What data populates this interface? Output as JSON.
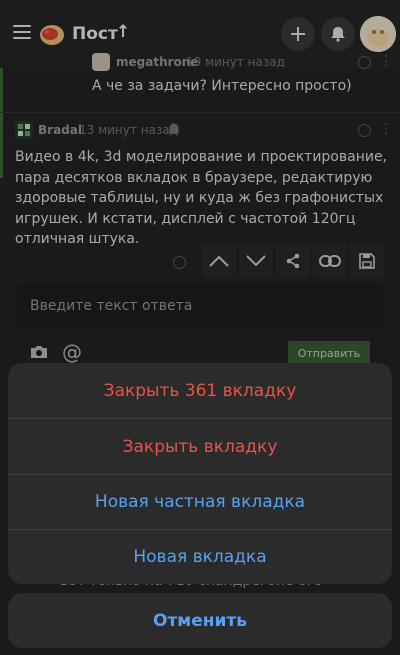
{
  "header": {
    "title": "Пост",
    "up_arrow": "↑"
  },
  "comment1": {
    "author": "megathrone",
    "time": "19 минут назад",
    "text": "А че за задачи? Интересно просто)"
  },
  "comment2": {
    "author": "Bradal",
    "time": "13 минут назад",
    "text": "Видео в 4k, 3d моделирование и проектирование, пара десятков вкладок в браузере, редактирую здоровые таблицы, ну и куда ж без графонистых игрушек. И кстати, дисплей с частотой 120гц отличная штука."
  },
  "reply": {
    "placeholder": "Введите текст ответа",
    "send_label": "Отправить"
  },
  "behind_text": "вот только на 710 снапдрегоне ого оперативки",
  "sheet": {
    "items": [
      {
        "label": "Закрыть 361 вкладку",
        "color": "#e8534a"
      },
      {
        "label": "Закрыть вкладку",
        "color": "#e8534a"
      },
      {
        "label": "Новая частная вкладка",
        "color": "#5aa0ee"
      },
      {
        "label": "Новая вкладка",
        "color": "#5aa0ee"
      }
    ],
    "cancel_label": "Отменить"
  },
  "icons": [
    "menu-icon",
    "logo-icon",
    "plus-icon",
    "bell-icon",
    "clock-icon",
    "more-icon",
    "android-icon",
    "chevron-up-icon",
    "chevron-down-icon",
    "share-icon",
    "link-icon",
    "save-icon",
    "camera-icon",
    "at-icon"
  ]
}
